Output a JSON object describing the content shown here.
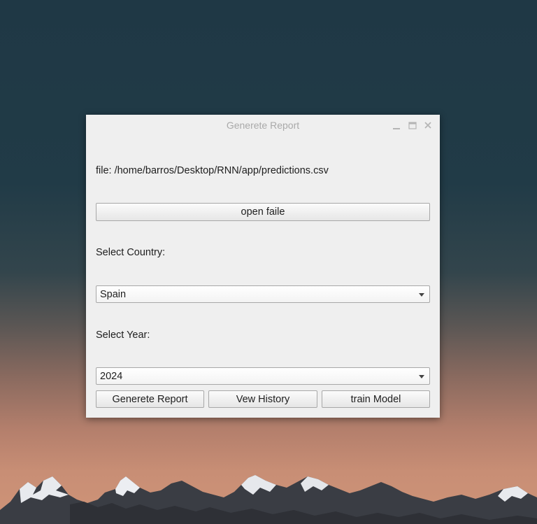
{
  "window": {
    "title": "Generete Report",
    "controls": {
      "minimize_icon": "minimize-icon",
      "maximize_icon": "maximize-icon",
      "close_icon": "close-icon"
    }
  },
  "form": {
    "file_label": "file: /home/barros/Desktop/RNN/app/predictions.csv",
    "open_file_button": "open faile",
    "country_label": "Select Country:",
    "country_value": "Spain",
    "year_label": "Select Year:",
    "year_value": "2024"
  },
  "actions": {
    "generate_report": "Generete Report",
    "view_history": "Vew History",
    "train_model": "train Model"
  }
}
